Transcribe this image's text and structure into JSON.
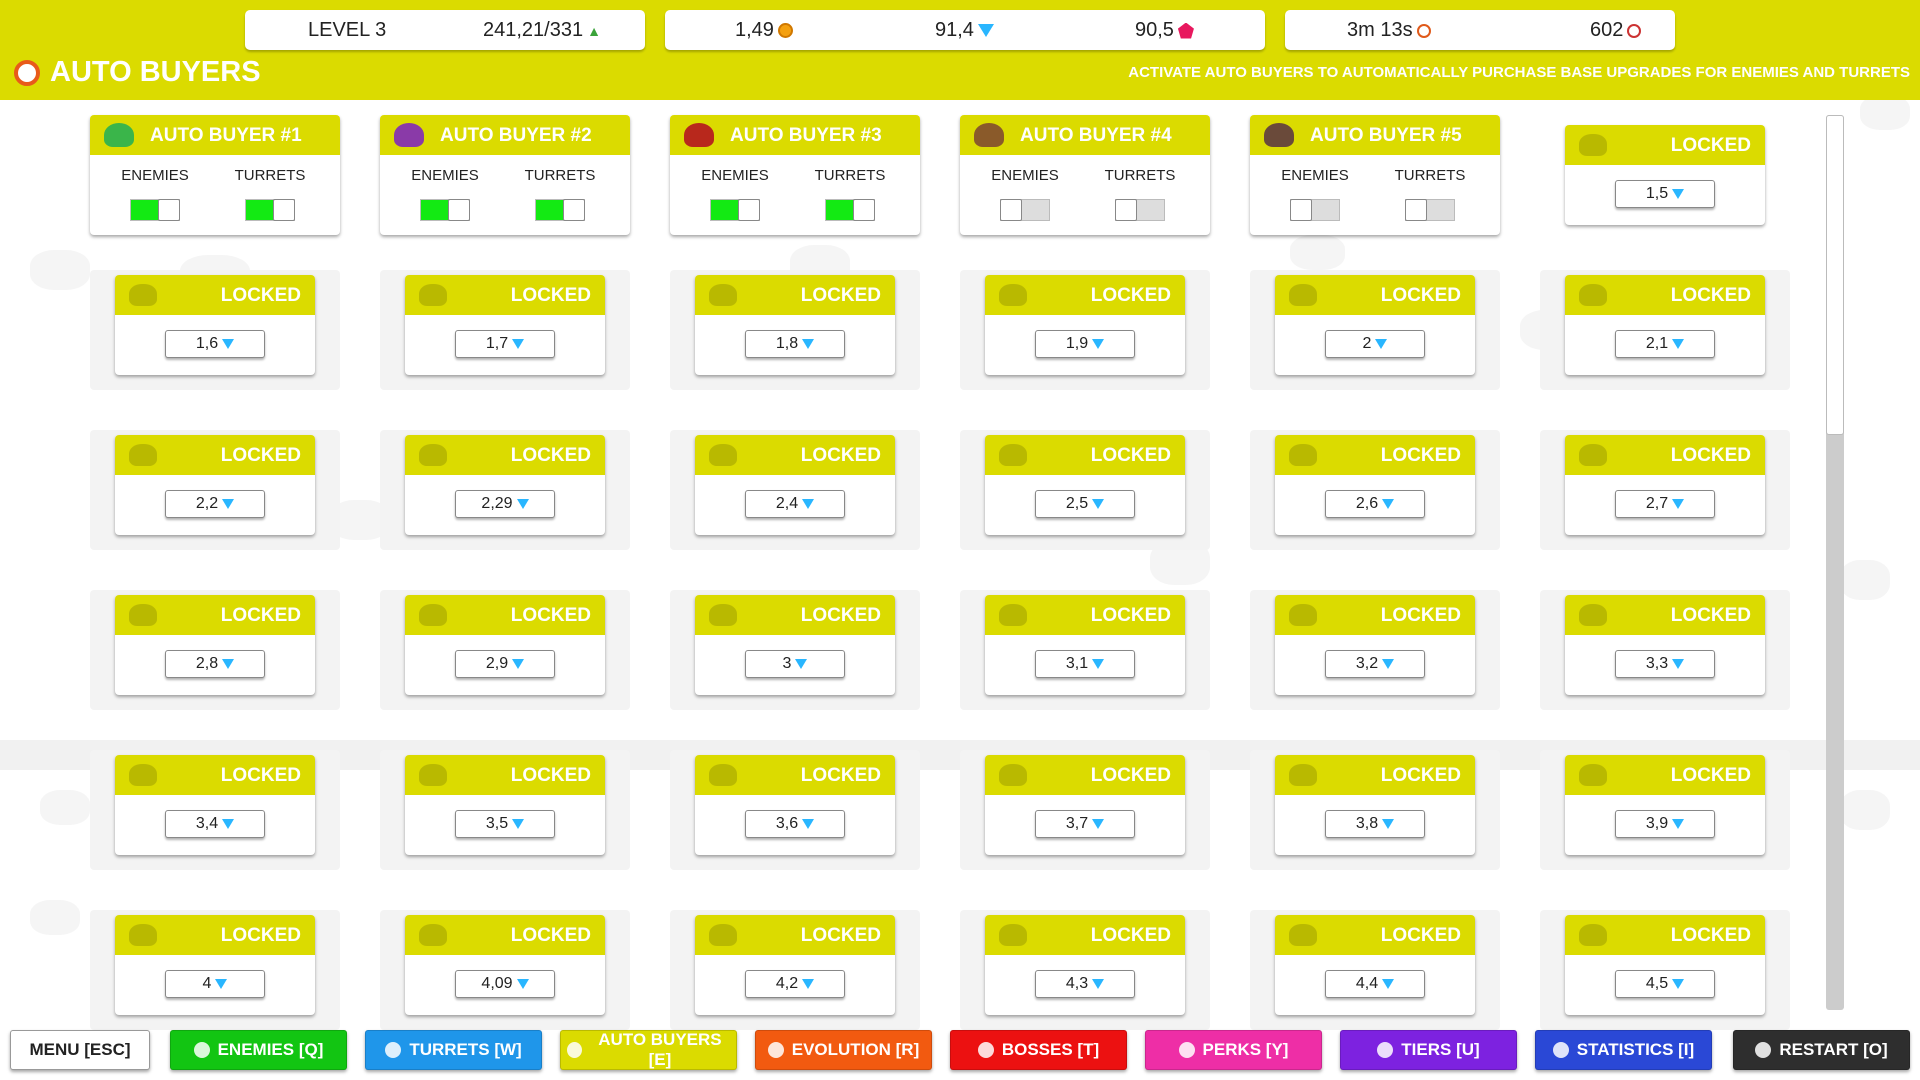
{
  "header": {
    "level": "LEVEL 3",
    "exp": "241,21/331",
    "exp_icon": "exp-icon",
    "coins": "1,49",
    "gems": "91,4",
    "rubies": "90,5",
    "time": "3m 13s",
    "kills": "602"
  },
  "page": {
    "title": "AUTO BUYERS",
    "subtitle": "ACTIVATE AUTO BUYERS TO AUTOMATICALLY PURCHASE BASE UPGRADES FOR ENEMIES AND TURRETS"
  },
  "auto_buyers": [
    {
      "title": "AUTO BUYER #1",
      "enemies_label": "ENEMIES",
      "turrets_label": "TURRETS",
      "enemies_on": true,
      "turrets_on": true,
      "icon_color": "#3ab54a"
    },
    {
      "title": "AUTO BUYER #2",
      "enemies_label": "ENEMIES",
      "turrets_label": "TURRETS",
      "enemies_on": true,
      "turrets_on": true,
      "icon_color": "#8a3aa8"
    },
    {
      "title": "AUTO BUYER #3",
      "enemies_label": "ENEMIES",
      "turrets_label": "TURRETS",
      "enemies_on": true,
      "turrets_on": true,
      "icon_color": "#b8281c"
    },
    {
      "title": "AUTO BUYER #4",
      "enemies_label": "ENEMIES",
      "turrets_label": "TURRETS",
      "enemies_on": false,
      "turrets_on": false,
      "icon_color": "#8a5a2a"
    },
    {
      "title": "AUTO BUYER #5",
      "enemies_label": "ENEMIES",
      "turrets_label": "TURRETS",
      "enemies_on": false,
      "turrets_on": false,
      "icon_color": "#6a4a3a"
    }
  ],
  "locked_label": "LOCKED",
  "locked_prices": [
    "1,5",
    "1,6",
    "1,7",
    "1,8",
    "1,9",
    "2",
    "2,1",
    "2,2",
    "2,29",
    "2,4",
    "2,5",
    "2,6",
    "2,7",
    "2,8",
    "2,9",
    "3",
    "3,1",
    "3,2",
    "3,3",
    "3,4",
    "3,5",
    "3,6",
    "3,7",
    "3,8",
    "3,9",
    "4",
    "4,09",
    "4,2",
    "4,3",
    "4,4",
    "4,5"
  ],
  "nav": [
    {
      "label": "MENU [ESC]",
      "color": "#ffffff",
      "text": "#222222",
      "icon": ""
    },
    {
      "label": "ENEMIES [Q]",
      "color": "#12c512",
      "text": "#ffffff",
      "icon": "coin-icon"
    },
    {
      "label": "TURRETS [W]",
      "color": "#1f96ea",
      "text": "#ffffff",
      "icon": "swords-icon"
    },
    {
      "label": "AUTO BUYERS [E]",
      "color": "#dbdb00",
      "text": "#ffffff",
      "icon": "clock-icon"
    },
    {
      "label": "EVOLUTION [R]",
      "color": "#f25a10",
      "text": "#ffffff",
      "icon": "star-icon"
    },
    {
      "label": "BOSSES [T]",
      "color": "#ec1111",
      "text": "#ffffff",
      "icon": "skull-icon"
    },
    {
      "label": "PERKS [Y]",
      "color": "#ee2ea6",
      "text": "#ffffff",
      "icon": "badge-icon"
    },
    {
      "label": "TIERS [U]",
      "color": "#7d22e0",
      "text": "#ffffff",
      "icon": "pyramid-icon"
    },
    {
      "label": "STATISTICS [I]",
      "color": "#2a48d6",
      "text": "#ffffff",
      "icon": "bar-chart-icon"
    },
    {
      "label": "RESTART [O]",
      "color": "#2e2e2e",
      "text": "#ffffff",
      "icon": "restart-icon"
    }
  ],
  "colors": {
    "accent": "#dbdb00",
    "toggle_on": "#13ea13",
    "gem": "#29b6ff"
  }
}
